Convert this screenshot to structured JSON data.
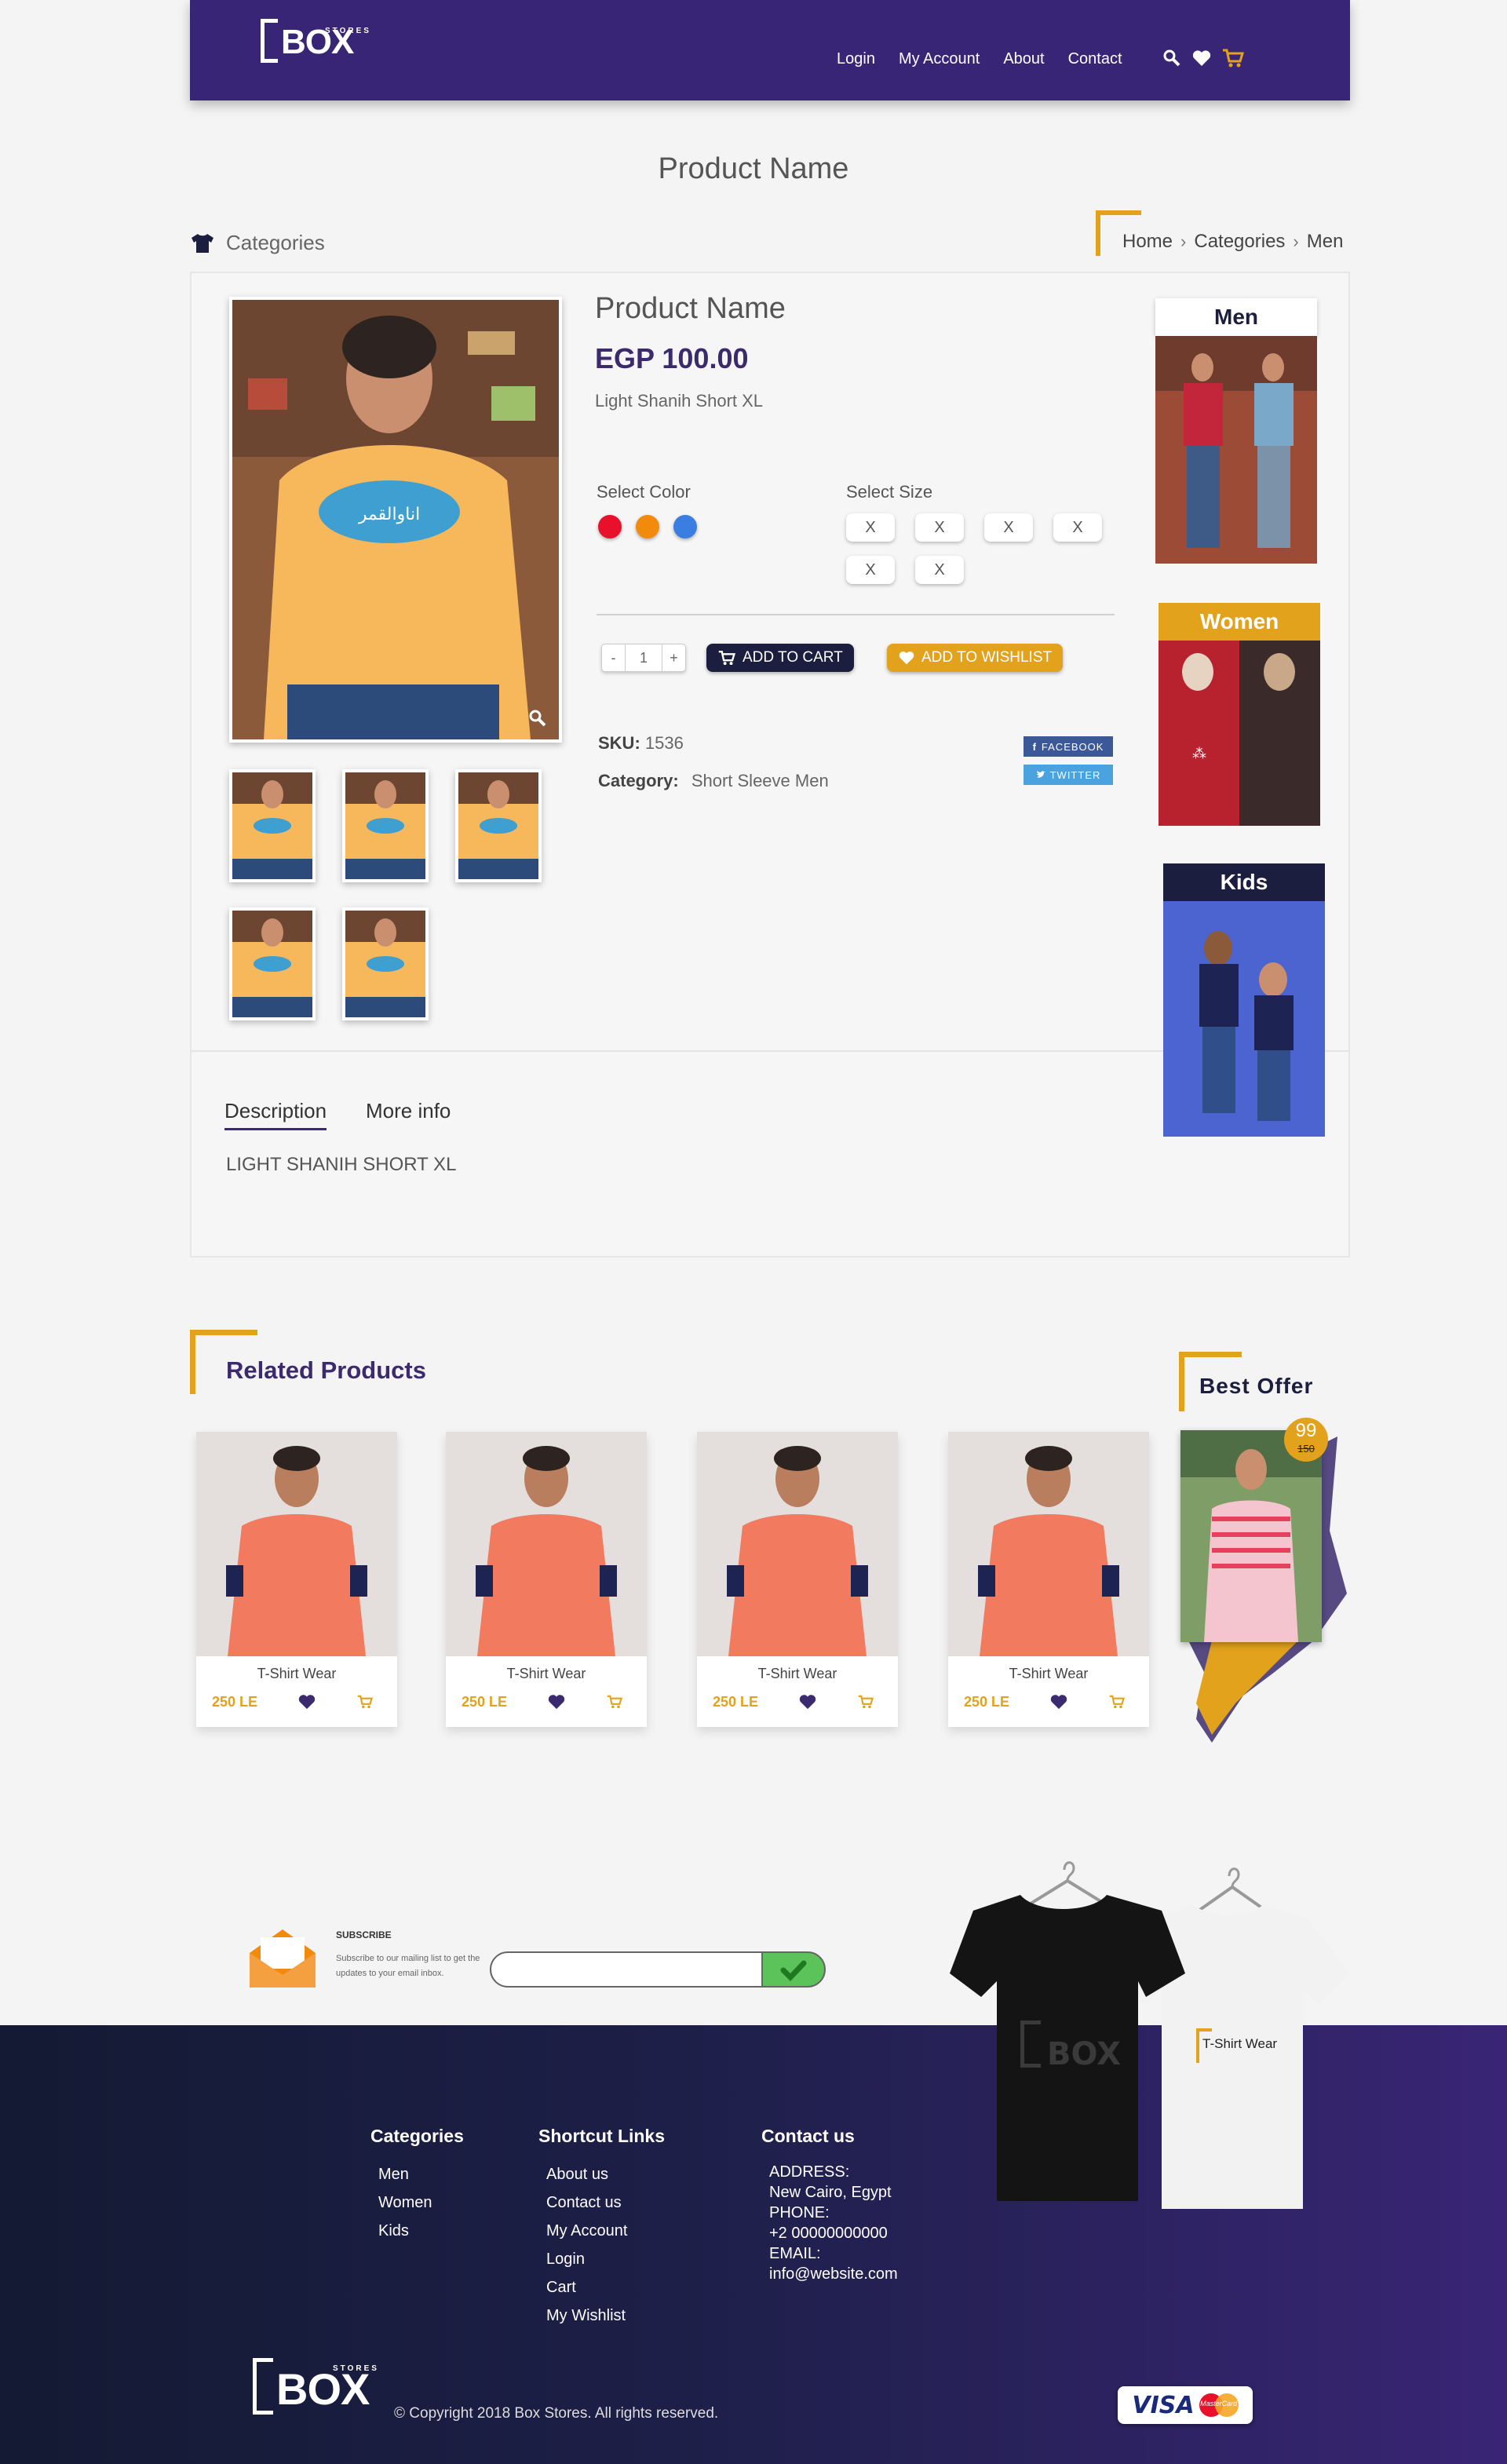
{
  "header": {
    "logo_word": "BOX",
    "logo_small": "STORES",
    "nav": [
      "Login",
      "My Account",
      "About",
      "Contact"
    ]
  },
  "page_title": "Product Name",
  "categories_label": "Categories",
  "breadcrumb": [
    "Home",
    "Categories",
    "Men"
  ],
  "product": {
    "name": "Product Name",
    "price": "EGP 100.00",
    "subtitle": "Light Shanih Short XL",
    "color_label": "Select Color",
    "colors": [
      "#e8102a",
      "#f28b0c",
      "#3a7ee2"
    ],
    "size_label": "Select Size",
    "sizes": [
      "X",
      "X",
      "X",
      "X",
      "X",
      "X"
    ],
    "quantity": "1",
    "qty_minus": "-",
    "qty_plus": "+",
    "add_to_cart": "ADD TO CART",
    "add_to_wishlist": "ADD TO WISHLIST",
    "sku_label": "SKU:",
    "sku_value": "1536",
    "category_label": "Category:",
    "category_value": "Short Sleeve Men",
    "facebook": "FACEBOOK",
    "twitter": "TWITTER"
  },
  "sidebar_categories": [
    {
      "label": "Men",
      "head_bg": "#ffffff",
      "head_color": "#1b1e3e"
    },
    {
      "label": "Women",
      "head_bg": "#e2a21b",
      "head_color": "#ffffff"
    },
    {
      "label": "Kids",
      "head_bg": "#1b1e3e",
      "head_color": "#ffffff"
    }
  ],
  "tabs": [
    "Description",
    "More info"
  ],
  "description_text": "LIGHT SHANIH SHORT XL",
  "related": {
    "title": "Related Products",
    "items": [
      {
        "name": "T-Shirt Wear",
        "price": "250 LE"
      },
      {
        "name": "T-Shirt Wear",
        "price": "250 LE"
      },
      {
        "name": "T-Shirt Wear",
        "price": "250 LE"
      },
      {
        "name": "T-Shirt Wear",
        "price": "250 LE"
      }
    ]
  },
  "best_offer": {
    "title": "Best Offer",
    "badge_new": "99",
    "badge_old": "150"
  },
  "subscribe": {
    "title": "SUBSCRIBE",
    "text": "Subscribe to our mailing list to get the updates to your email inbox.",
    "placeholder": ""
  },
  "promo_shirt_label": "T-Shirt Wear",
  "footer": {
    "categories_title": "Categories",
    "categories": [
      "Men",
      "Women",
      "Kids"
    ],
    "links_title": "Shortcut Links",
    "links": [
      "About us",
      "Contact us",
      "My Account",
      "Login",
      "Cart",
      "My Wishlist"
    ],
    "contact_title": "Contact us",
    "contact": [
      "ADDRESS:",
      "New Cairo, Egypt",
      "PHONE:",
      "+2 00000000000",
      "EMAIL:",
      "info@website.com"
    ],
    "copyright": "© Copyright 2018 Box Stores. All rights reserved.",
    "visa": "VISA",
    "mastercard": "MasterCard"
  },
  "colors": {
    "brand_purple": "#392575",
    "accent_gold": "#e2a21b",
    "navy": "#1b1e3e"
  }
}
